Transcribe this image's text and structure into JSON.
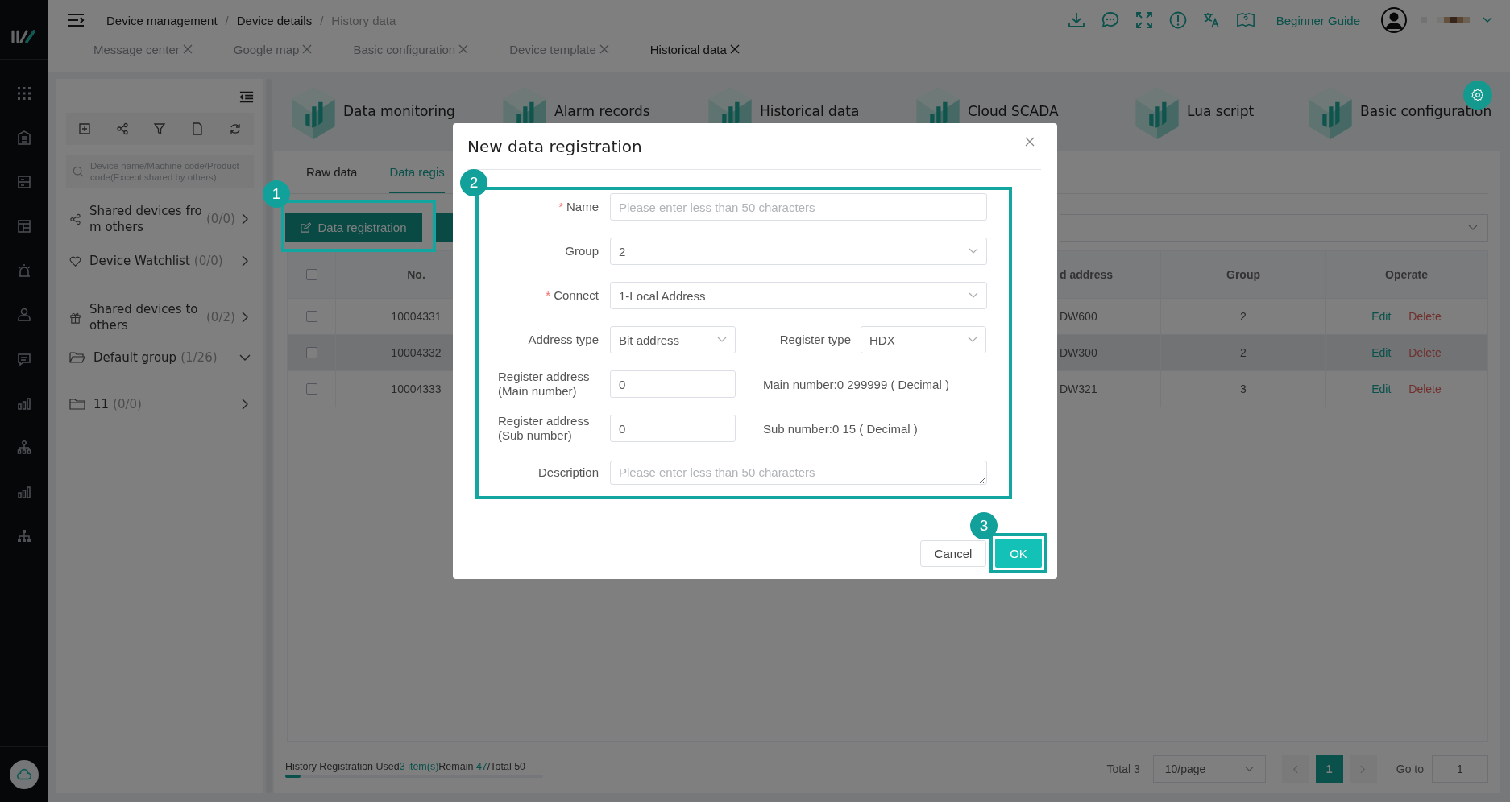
{
  "breadcrumb": [
    {
      "label": "Device management",
      "current": false,
      "separator": "/"
    },
    {
      "label": "Device details",
      "current": false,
      "separator": "/"
    },
    {
      "label": "History data",
      "current": true
    }
  ],
  "page_tabs": [
    {
      "label": "Message center",
      "selected": false
    },
    {
      "label": "Google map",
      "selected": false
    },
    {
      "label": "Basic configuration",
      "selected": false
    },
    {
      "label": "Device template",
      "selected": false
    },
    {
      "label": "Historical data",
      "selected": true
    }
  ],
  "header_actions": {
    "guide_link": "Beginner Guide"
  },
  "device_panel": {
    "search": {
      "placeholder": "Device name/Machine code/Product code(Except shared by others)"
    },
    "items": [
      {
        "kind": "share",
        "label": "Shared devices from others",
        "count": "(0/0)",
        "expanded": false
      },
      {
        "kind": "favorite",
        "label": "Device Watchlist",
        "count": "(0/0)",
        "expanded": false
      },
      {
        "kind": "gift",
        "label": "Shared devices to others",
        "count": "(0/2)",
        "expanded": false
      },
      {
        "kind": "group",
        "label": "Default group",
        "count": "(1/26)",
        "expanded": true
      },
      {
        "kind": "folder",
        "label": "11",
        "count": "(0/0)",
        "expanded": false
      }
    ]
  },
  "modules": [
    {
      "label": "Data monitoring"
    },
    {
      "label": "Alarm records"
    },
    {
      "label": "Historical data"
    },
    {
      "label": "Cloud SCADA"
    },
    {
      "label": "Lua script"
    },
    {
      "label": "Basic configuration"
    }
  ],
  "data_tabs": [
    {
      "label": "Raw data",
      "selected": false
    },
    {
      "label": "Data regis",
      "selected": true
    }
  ],
  "actions": {
    "register_button": "Data registration"
  },
  "table": {
    "header_checked": false,
    "columns": [
      "No.",
      "d address",
      "Group",
      "Operate"
    ],
    "rows": [
      {
        "checked": false,
        "highlighted": false,
        "no": "10004331",
        "address": "DW600",
        "group": "2",
        "edit": "Edit",
        "delete": "Delete"
      },
      {
        "checked": false,
        "highlighted": true,
        "no": "10004332",
        "address": "DW300",
        "group": "2",
        "edit": "Edit",
        "delete": "Delete"
      },
      {
        "checked": false,
        "highlighted": false,
        "no": "10004333",
        "address": "DW321",
        "group": "3",
        "edit": "Edit",
        "delete": "Delete"
      }
    ]
  },
  "footer": {
    "usage": [
      {
        "text": "History Registration Used",
        "accent": false
      },
      {
        "text": "3 item(s)",
        "accent": true
      },
      {
        "text": "Remain ",
        "accent": false
      },
      {
        "text": "47",
        "accent": true
      },
      {
        "text": "/Total 50",
        "accent": false
      }
    ],
    "usage_bar": {
      "level": 0.06
    }
  },
  "pagination": {
    "total": "Total 3",
    "page_size": "10/page",
    "pages": [
      {
        "label": "1",
        "selected": true
      }
    ],
    "goto_label": "Go to",
    "goto_value": "1"
  },
  "modal": {
    "title": "New data registration",
    "rows": [
      {
        "fields": [
          {
            "kind": "input",
            "label": "Name",
            "required_mark": "*",
            "placeholder": "Please enter less than 50 characters"
          }
        ]
      },
      {
        "fields": [
          {
            "kind": "select",
            "label": "Group",
            "value": "2"
          }
        ]
      },
      {
        "fields": [
          {
            "kind": "select",
            "label": "Connect",
            "required_mark": "*",
            "value": "1-Local Address"
          }
        ]
      },
      {
        "fields": [
          {
            "kind": "select",
            "label": "Address type",
            "value": "Bit address"
          },
          {
            "kind": "select",
            "label": "Register type",
            "value": "HDX"
          }
        ]
      },
      {
        "fields": [
          {
            "kind": "input",
            "label": "Register address (Main number)",
            "value": "0"
          }
        ],
        "hint": "Main number:0 299999 ( Decimal )"
      },
      {
        "fields": [
          {
            "kind": "input",
            "label": "Register address (Sub number)",
            "value": "0"
          }
        ],
        "hint": "Sub number:0 15 ( Decimal )"
      },
      {
        "fields": [
          {
            "kind": "textarea",
            "label": "Description",
            "placeholder": "Please enter less than 50 characters"
          }
        ]
      }
    ],
    "cancel": "Cancel",
    "ok": "OK"
  },
  "annotations": [
    {
      "label": "1"
    },
    {
      "label": "2"
    },
    {
      "label": "3"
    }
  ]
}
